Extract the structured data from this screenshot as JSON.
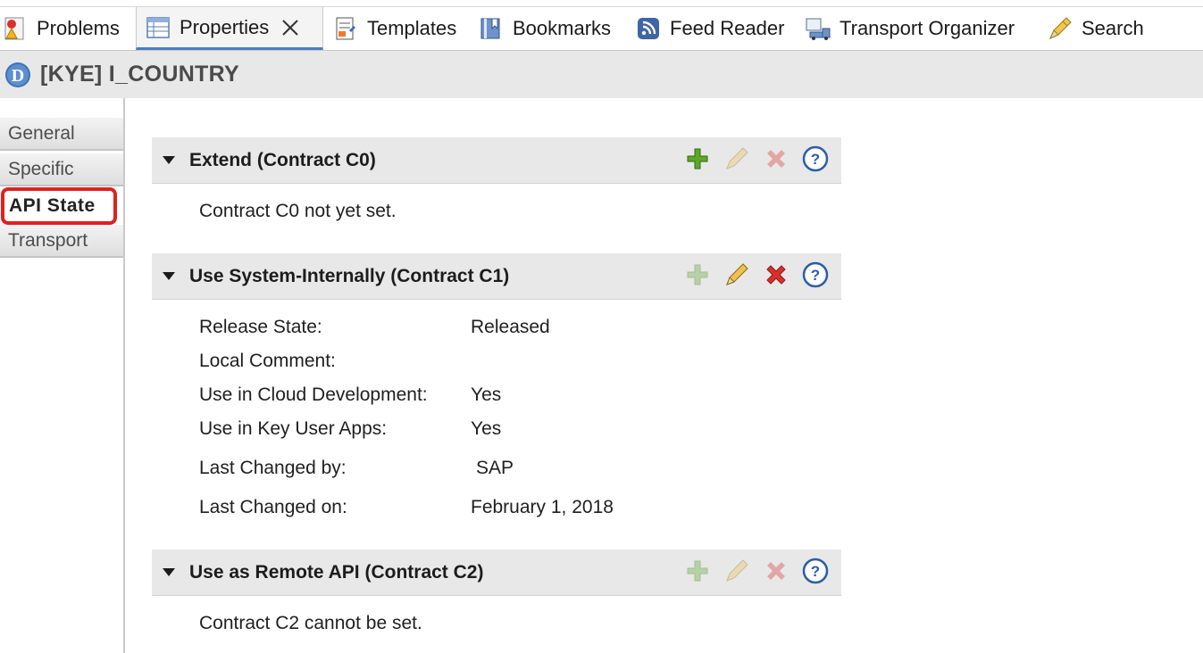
{
  "tabs": [
    {
      "label": "Problems",
      "icon": "problems-icon"
    },
    {
      "label": "Properties",
      "icon": "properties-icon",
      "active": true
    },
    {
      "label": "Templates",
      "icon": "templates-icon"
    },
    {
      "label": "Bookmarks",
      "icon": "bookmarks-icon"
    },
    {
      "label": "Feed Reader",
      "icon": "feed-reader-icon"
    },
    {
      "label": "Transport Organizer",
      "icon": "transport-organizer-icon"
    },
    {
      "label": "Search",
      "icon": "search-icon"
    }
  ],
  "header": {
    "badge": "D",
    "title": "[KYE] I_COUNTRY"
  },
  "nav": {
    "items": [
      "General",
      "Specific",
      "API State",
      "Transport"
    ],
    "selected": "API State"
  },
  "sections": {
    "c0": {
      "title": "Extend (Contract C0)",
      "message": "Contract C0 not yet set."
    },
    "c1": {
      "title": "Use System-Internally (Contract C1)",
      "fields": [
        {
          "label": "Release State:",
          "value": "Released"
        },
        {
          "label": "Local Comment:",
          "value": ""
        },
        {
          "label": "Use in Cloud Development:",
          "value": "Yes"
        },
        {
          "label": "Use in Key User Apps:",
          "value": "Yes"
        },
        {
          "label": "Last Changed by:",
          "value": "SAP"
        },
        {
          "label": "Last Changed on:",
          "value": "February 1, 2018"
        }
      ]
    },
    "c2": {
      "title": "Use as Remote API (Contract C2)",
      "message": "Contract C2 cannot be set."
    }
  },
  "colors": {
    "accent_underline": "#4f7bbf",
    "selection_outline": "#e0211d",
    "add_green": "#4c9a1a",
    "delete_red": "#d9302c",
    "help_blue": "#2b5ea8"
  }
}
